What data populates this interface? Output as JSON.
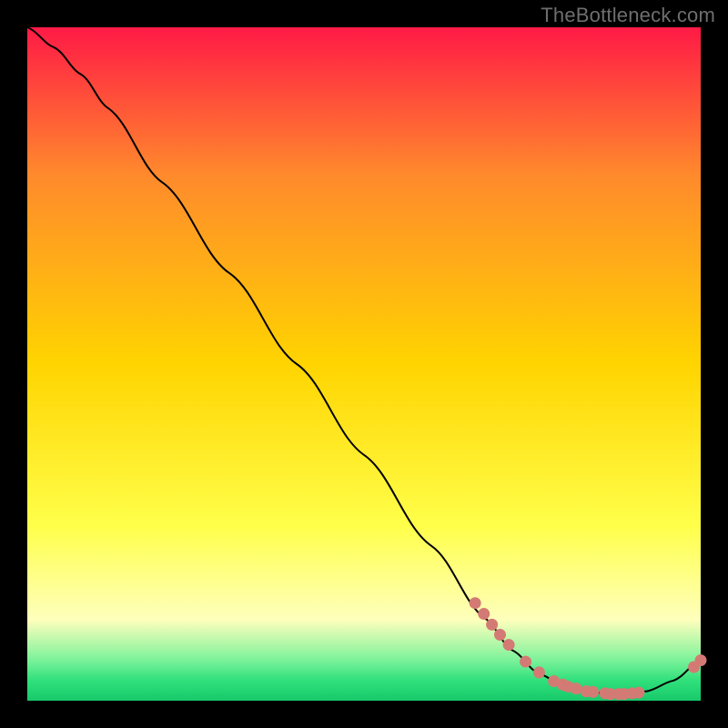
{
  "watermark": "TheBottleneck.com",
  "plot_colors": {
    "bg_black": "#000000",
    "curve": "#000000",
    "point_fill": "#d47a74",
    "grad_top": "#ff1a46",
    "grad_mid_upper": "#ff8a2c",
    "grad_mid": "#ffd400",
    "grad_mid_lower": "#ffff4a",
    "grad_pale": "#feffbc",
    "grad_green1": "#7bf29a",
    "grad_green2": "#2fe07b",
    "grad_bottom": "#18c96b"
  },
  "chart_data": {
    "type": "line",
    "title": "",
    "xlabel": "",
    "ylabel": "",
    "xlim": [
      0,
      100
    ],
    "ylim": [
      0,
      100
    ],
    "curve": [
      {
        "x": 0,
        "y": 100
      },
      {
        "x": 4,
        "y": 97
      },
      {
        "x": 8,
        "y": 93
      },
      {
        "x": 12,
        "y": 88
      },
      {
        "x": 20,
        "y": 77
      },
      {
        "x": 30,
        "y": 63.5
      },
      {
        "x": 40,
        "y": 50
      },
      {
        "x": 50,
        "y": 36.5
      },
      {
        "x": 60,
        "y": 23
      },
      {
        "x": 68,
        "y": 12.2
      },
      {
        "x": 72,
        "y": 7.5
      },
      {
        "x": 76,
        "y": 4.0
      },
      {
        "x": 80,
        "y": 2.0
      },
      {
        "x": 84,
        "y": 1.2
      },
      {
        "x": 88,
        "y": 1.0
      },
      {
        "x": 92,
        "y": 1.4
      },
      {
        "x": 96,
        "y": 3.0
      },
      {
        "x": 100,
        "y": 6.0
      }
    ],
    "points": [
      {
        "x": 66.5,
        "y": 14.5
      },
      {
        "x": 67.8,
        "y": 12.9
      },
      {
        "x": 69.0,
        "y": 11.3
      },
      {
        "x": 70.2,
        "y": 9.8
      },
      {
        "x": 71.5,
        "y": 8.3
      },
      {
        "x": 74.0,
        "y": 5.8
      },
      {
        "x": 76.0,
        "y": 4.2
      },
      {
        "x": 78.2,
        "y": 2.9
      },
      {
        "x": 79.5,
        "y": 2.4
      },
      {
        "x": 80.3,
        "y": 2.1
      },
      {
        "x": 81.5,
        "y": 1.8
      },
      {
        "x": 83.0,
        "y": 1.4
      },
      {
        "x": 84.0,
        "y": 1.3
      },
      {
        "x": 85.8,
        "y": 1.1
      },
      {
        "x": 86.6,
        "y": 1.0
      },
      {
        "x": 87.8,
        "y": 1.0
      },
      {
        "x": 88.6,
        "y": 1.0
      },
      {
        "x": 89.8,
        "y": 1.1
      },
      {
        "x": 90.8,
        "y": 1.2
      },
      {
        "x": 99.0,
        "y": 5.0
      },
      {
        "x": 100.0,
        "y": 6.0
      }
    ]
  }
}
